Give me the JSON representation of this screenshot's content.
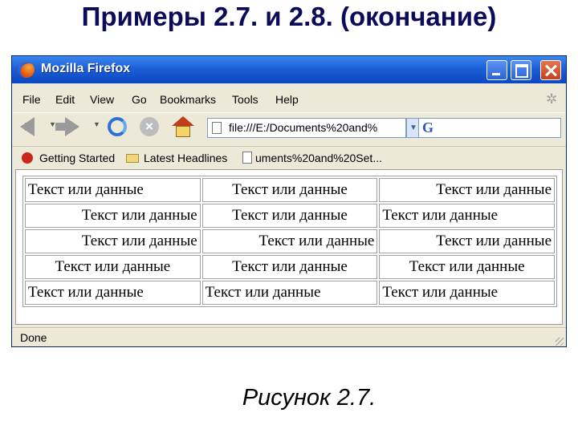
{
  "slide": {
    "title": "Примеры 2.7. и 2.8. (окончание)",
    "caption": "Рисунок 2.7."
  },
  "window": {
    "title": "Mozilla Firefox",
    "menu": [
      "File",
      "Edit",
      "View",
      "Go",
      "Bookmarks",
      "Tools",
      "Help"
    ],
    "url": "file:///E:/Documents%20and%",
    "bookmarks": [
      "Getting Started",
      "Latest Headlines",
      "uments%20and%20Set..."
    ],
    "status": "Done"
  },
  "table": {
    "rows": [
      [
        {
          "text": "Текст или данные",
          "align": "left"
        },
        {
          "text": "Текст или данные",
          "align": "center"
        },
        {
          "text": "Текст или данные",
          "align": "right"
        }
      ],
      [
        {
          "text": "Текст или данные",
          "align": "right"
        },
        {
          "text": "Текст или данные",
          "align": "center"
        },
        {
          "text": "Текст или данные",
          "align": "left"
        }
      ],
      [
        {
          "text": "Текст или данные",
          "align": "right"
        },
        {
          "text": "Текст или данные",
          "align": "right"
        },
        {
          "text": "Текст или данные",
          "align": "right"
        }
      ],
      [
        {
          "text": "Текст или данные",
          "align": "center"
        },
        {
          "text": "Текст или данные",
          "align": "center"
        },
        {
          "text": "Текст или данные",
          "align": "center"
        }
      ],
      [
        {
          "text": "Текст или данные",
          "align": "left"
        },
        {
          "text": "Текст или данные",
          "align": "left"
        },
        {
          "text": "Текст или данные",
          "align": "left"
        }
      ]
    ]
  },
  "icons": {
    "titlebar": "firefox-icon",
    "buttons": [
      "minimize-icon",
      "maximize-icon",
      "close-icon"
    ],
    "nav": [
      "back-arrow-icon",
      "forward-arrow-icon",
      "reload-icon",
      "stop-icon",
      "home-icon"
    ],
    "search": "google-icon"
  },
  "colors": {
    "titlebar": "#1d5fd6",
    "slide_title": "#0b0b5a"
  }
}
